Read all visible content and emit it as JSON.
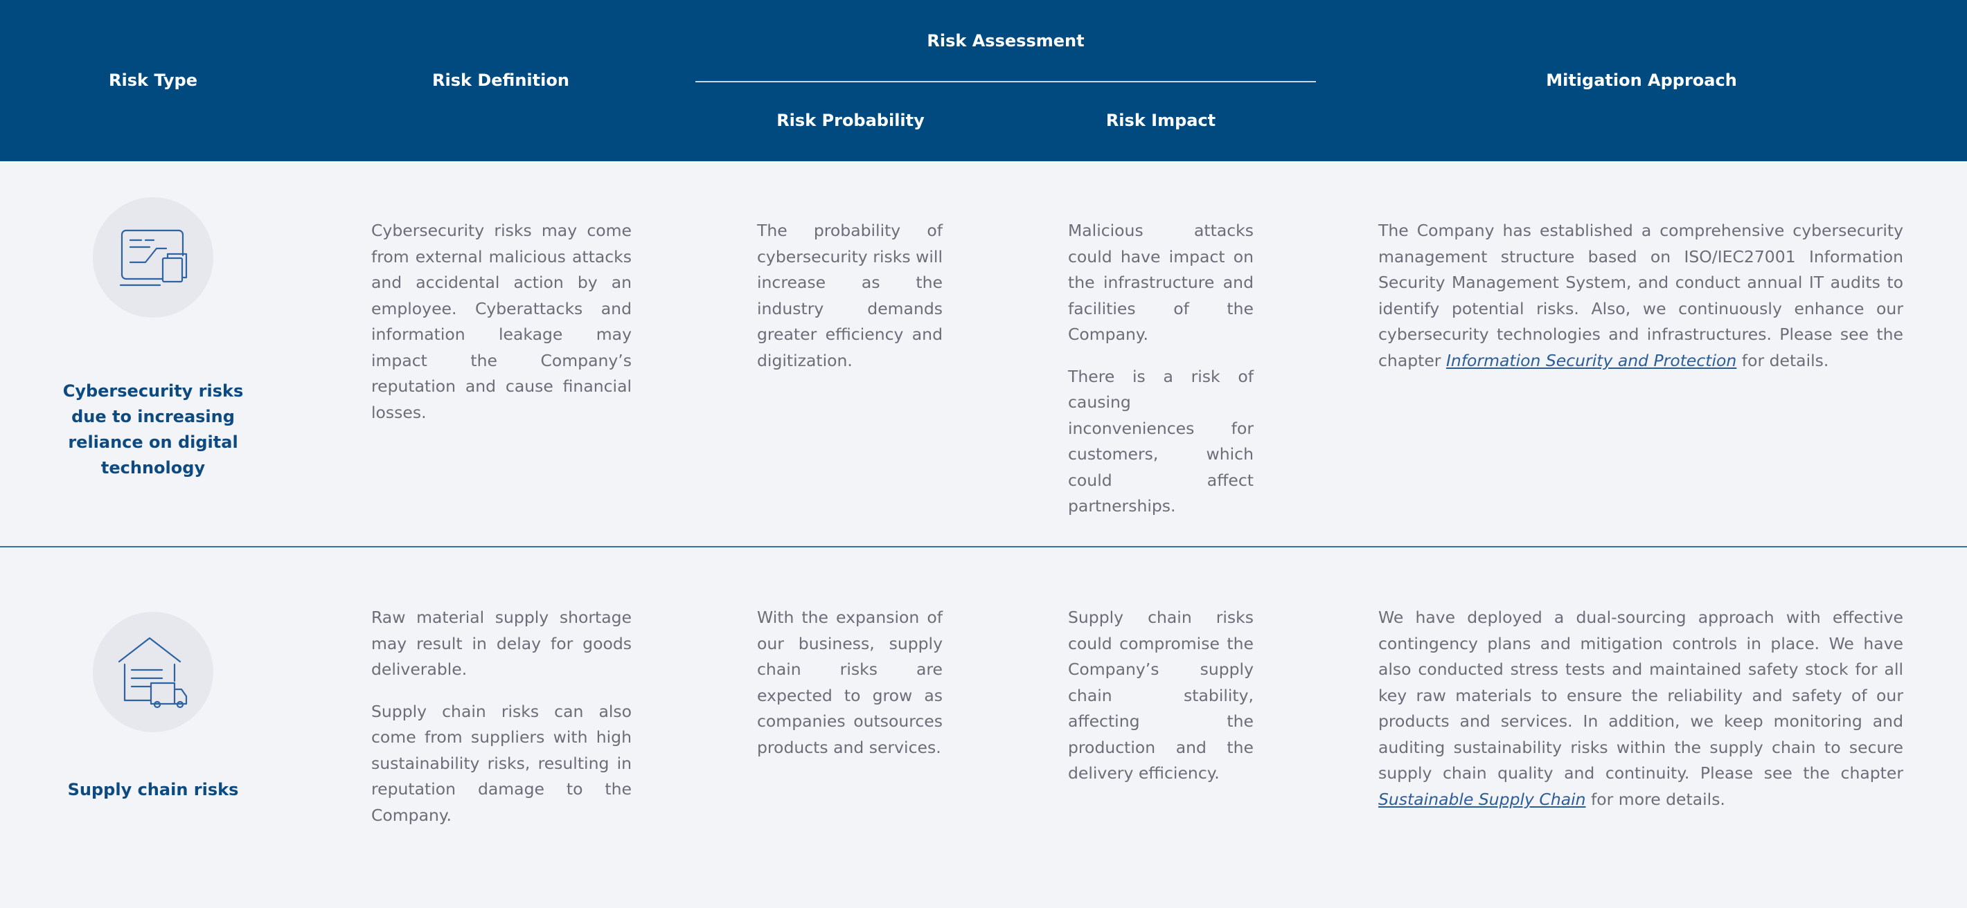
{
  "header": {
    "risk_type": "Risk Type",
    "risk_definition": "Risk Definition",
    "risk_assessment": "Risk Assessment",
    "risk_probability": "Risk Probability",
    "risk_impact": "Risk Impact",
    "mitigation_approach": "Mitigation Approach"
  },
  "rows": [
    {
      "icon": "cybersecurity-screen-icon",
      "title": "Cybersecurity risks due to increasing reliance on digital technology",
      "definition": [
        "Cybersecurity risks may come from external malicious attacks and accidental action by an employee. Cyberattacks and information leakage may impact the Company’s reputation and cause financial losses."
      ],
      "probability": [
        "The probability of cybersecurity risks will increase as the industry demands greater efficiency and digitization."
      ],
      "impact": [
        "Malicious attacks could have impact on the infrastructure and facilities of the Company.",
        "There is a risk of causing inconveniences for customers, which could affect partnerships."
      ],
      "mitigation": {
        "before": "The Company has established a comprehensive cybersecurity management structure based on ISO/IEC27001 Information Security Management System, and conduct annual IT audits to identify potential risks. Also, we continuously enhance our cybersecurity technologies and infrastructures. Please see the chapter ",
        "link": "Information Security and Protection",
        "after": " for details."
      }
    },
    {
      "icon": "warehouse-truck-icon",
      "title": "Supply chain risks",
      "definition": [
        "Raw material supply shortage may result in delay for goods deliverable.",
        "Supply chain risks can also come from suppliers with high sustainability risks, resulting in reputation damage to the Company."
      ],
      "probability": [
        "With the expansion of our business, supply chain risks are expected to grow as companies outsources products and services."
      ],
      "impact": [
        "Supply chain risks could compromise the Company’s supply chain stability, affecting the production and the delivery efficiency."
      ],
      "mitigation": {
        "before": "We have deployed a dual-sourcing approach with effective contingency plans and mitigation controls in place. We have also conducted stress tests and maintained safety stock for all key raw materials to ensure the reliability and safety of our products and services. In addition, we keep monitoring and auditing sustainability risks within the supply chain to secure supply chain quality and continuity. Please see the chapter ",
        "link": "Sustainable Supply Chain",
        "after": " for more details."
      }
    }
  ],
  "colors": {
    "header_bg": "#004a80",
    "body_bg": "#f3f4f8",
    "title_text": "#0c4a80",
    "body_text": "#6b6e78",
    "link": "#2a5d97",
    "icon_stroke": "#2e62a0"
  }
}
